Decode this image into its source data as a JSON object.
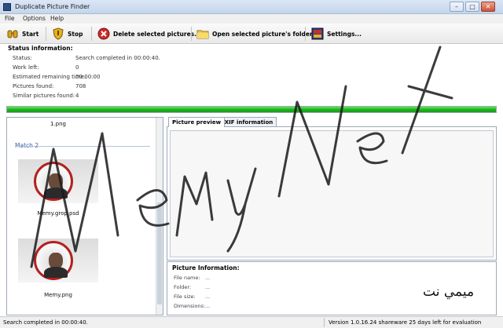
{
  "window": {
    "title": "Duplicate Picture Finder"
  },
  "menu": [
    "File",
    "Options",
    "Help"
  ],
  "toolbar": {
    "start": "Start",
    "stop": "Stop",
    "delete": "Delete selected pictures...",
    "open_folder": "Open selected picture's folder",
    "settings": "Settings..."
  },
  "status": {
    "title": "Status information:",
    "rows": [
      {
        "label": "Status:",
        "value": "Search completed in 00:00:40."
      },
      {
        "label": "Work left:",
        "value": "0"
      },
      {
        "label": "Estimated remaining time:",
        "value": "00:00:00"
      },
      {
        "label": "Pictures found:",
        "value": "708"
      },
      {
        "label": "Similar pictures found:",
        "value": "4"
      }
    ],
    "progress_percent": 100
  },
  "results": {
    "top_file": "1.png",
    "match_header": "Match 2",
    "files": [
      "Memy.grop.psd",
      "Memy.png"
    ]
  },
  "tabs": [
    "Picture preview",
    "EXIF information"
  ],
  "picture_info": {
    "title": "Picture Information:",
    "rows": [
      {
        "label": "File name:",
        "value": "..."
      },
      {
        "label": "Folder:",
        "value": "..."
      },
      {
        "label": "File size:",
        "value": "..."
      },
      {
        "label": "Dimensions:",
        "value": "..."
      }
    ]
  },
  "statusbar": {
    "left": "Search completed in 00:00:40.",
    "right": "Version 1.0.16.24 shareware 25 days left for evaluation"
  },
  "watermark": {
    "text": "Memy Net",
    "arabic": "ميمي نت"
  },
  "colors": {
    "progress": "#1fb31f",
    "match_header": "#3a5fa0"
  }
}
